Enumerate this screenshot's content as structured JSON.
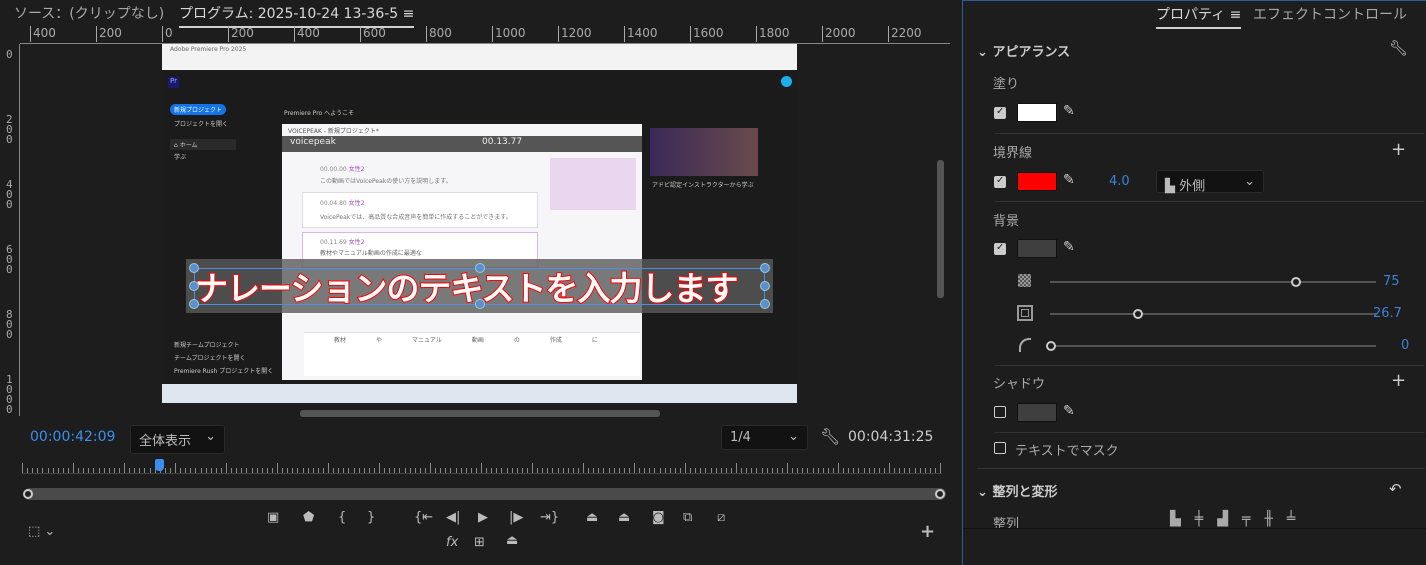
{
  "program_monitor": {
    "source_tab": "ソース：(クリップなし)",
    "program_tab": "プログラム: 2025-10-24 13-36-5",
    "menu_icon": "hamburger-icon",
    "ruler_h_labels": [
      "400",
      "200",
      "0",
      "200",
      "400",
      "600",
      "800",
      "1000",
      "1200",
      "1400",
      "1600",
      "1800",
      "2000",
      "2200"
    ],
    "ruler_v_labels": [
      "0",
      "200",
      "400",
      "600",
      "800",
      "1000"
    ],
    "caption_text": "ナレーションのテキストを入力します",
    "caption_fill": "#ffffff",
    "caption_stroke": "#ff0000",
    "timecode_current": "00:00:42:09",
    "zoom_select": "全体表示",
    "resolution_select": "1/4",
    "timecode_duration": "00:04:31:25",
    "playhead_fraction": 0.15
  },
  "embedded_video": {
    "app_title": "Adobe Premiere Pro 2025",
    "welcome": "Premiere Pro へようこそ",
    "new_project": "新規プロジェクト",
    "open_project": "プロジェクトを開く",
    "home": "ホーム",
    "learn": "学ぶ",
    "new_team": "新規チームプロジェクト",
    "open_team": "チームプロジェクトを開く",
    "open_rush": "Premiere Rush プロジェクトを開く",
    "learn_card": "アドビ認定インストラクターから学ぶ",
    "voicepeak_title": "VOICEPEAK - 新規プロジェクト*",
    "voicepeak_logo": "voicepeak",
    "voicepeak_time": "00.13.77",
    "rows": [
      {
        "time": "00.00.00",
        "voice": "女性2",
        "text": "この動画ではVoicePeakの使い方を説明します。"
      },
      {
        "time": "00.04.80",
        "voice": "女性2",
        "text": "VoicePeakでは、高品質な合成音声を簡単に作成することができます。"
      },
      {
        "time": "00.11.69",
        "voice": "女性2",
        "text": "教材やマニュアル動画の作成に最適な"
      }
    ],
    "phonemes": [
      "教材",
      "や",
      "マニュアル",
      "動画",
      "の",
      "作成",
      "に"
    ]
  },
  "properties_panel": {
    "tabs": [
      "プロパティ",
      "エフェクトコントロール"
    ],
    "appearance": "アピアランス",
    "fill_label": "塗り",
    "fill_color": "#ffffff",
    "fill_checked": true,
    "stroke_label": "境界線",
    "stroke_color": "#ff0000",
    "stroke_checked": true,
    "stroke_width": "4.0",
    "stroke_position": "外側",
    "background_label": "背景",
    "background_checked": true,
    "bg_opacity": "75",
    "bg_size": "26.7",
    "bg_corner": "0",
    "shadow_label": "シャドウ",
    "shadow_checked": false,
    "mask_label": "テキストでマスク",
    "mask_checked": false,
    "align_section": "整列と変形",
    "align_label": "整列"
  }
}
